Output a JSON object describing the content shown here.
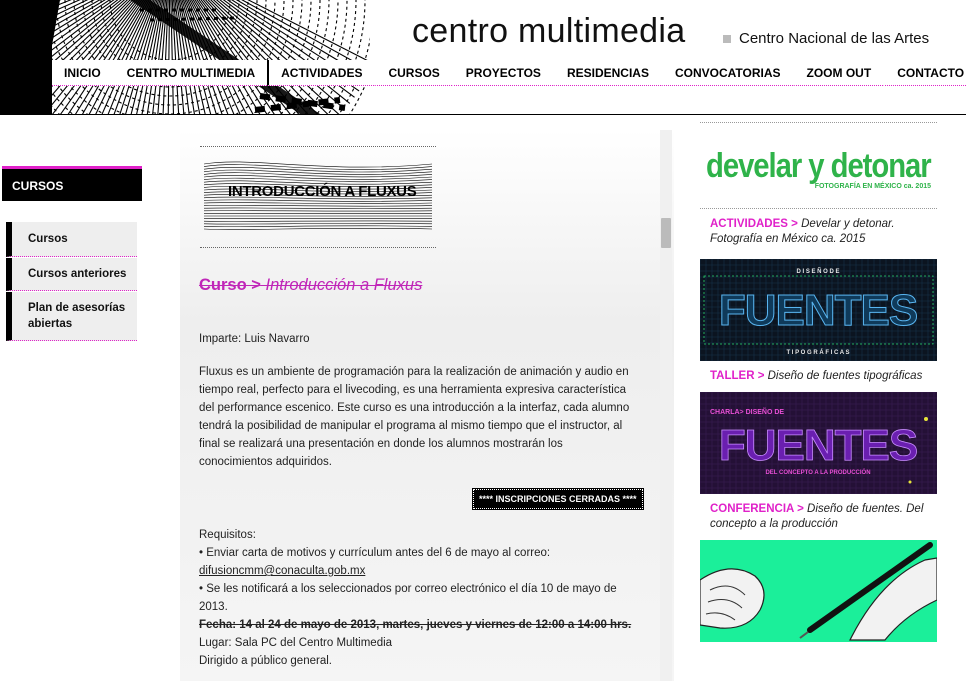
{
  "header": {
    "title": "centro multimedia",
    "subtitle": "Centro Nacional de las Artes"
  },
  "nav": {
    "items": [
      "INICIO",
      "CENTRO MULTIMEDIA",
      "ACTIVIDADES",
      "CURSOS",
      "PROYECTOS",
      "RESIDENCIAS",
      "CONVOCATORIAS",
      "ZOOM OUT",
      "CONTACTO"
    ]
  },
  "sidebar": {
    "title": "CURSOS",
    "items": [
      "Cursos",
      "Cursos anteriores",
      "Plan de asesorías abiertas"
    ]
  },
  "main": {
    "banner_text": "INTRODUCCIÓN A FLUXUS",
    "heading_category": "Curso >",
    "heading_name": "Introducción a Fluxus",
    "instructor": "Imparte: Luis Navarro",
    "description": "Fluxus es un ambiente de programación para la realización de animación y audio en tiempo real, perfecto para el livecoding, es una herramienta expresiva característica del performance escenico. Este curso es una introducción a la interfaz, cada alumno tendrá la posibilidad de manipular el programa al mismo tiempo que el instructor, al final se realizará una presentación en donde los alumnos mostrarán los conocimientos adquiridos.",
    "status_badge": "**** INSCRIPCIONES CERRADAS ****",
    "requirements_label": "Requisitos:",
    "requirement_1": "• Enviar carta de motivos y currículum antes del 6 de mayo al correo:",
    "email": "difusioncmm@conaculta.gob.mx",
    "requirement_2": "• Se les notificará a los seleccionados por correo electrónico el día 10 de mayo de 2013.",
    "date": "Fecha: 14 al 24 de mayo de 2013, martes, jueves y viernes de 12:00 a 14:00 hrs.",
    "place": "Lugar: Sala PC del Centro Multimedia",
    "audience": "Dirigido a público general."
  },
  "right": {
    "brand_title": "develar y detonar",
    "brand_subtitle": "FOTOGRAFÍA EN MÉXICO ca. 2015",
    "brand_color": "#2fb34a",
    "accent_color": "#e021c9",
    "items": [
      {
        "category": "ACTIVIDADES >",
        "text": "Develar y detonar. Fotografía en México ca. 2015"
      },
      {
        "category": "TALLER >",
        "text": "Diseño de fuentes tipográficas"
      },
      {
        "category": "CONFERENCIA >",
        "text": "Diseño de fuentes. Del concepto a la producción"
      }
    ],
    "banner1": {
      "top": "D I S E Ñ O   D E",
      "main": "FUENTES",
      "bottom": "T I P O G R Á F I C A S"
    },
    "banner2": {
      "top": "CHARLA> DISEÑO DE",
      "main": "FUENTES",
      "bottom": "DEL CONCEPTO A LA PRODUCCIÓN"
    }
  }
}
